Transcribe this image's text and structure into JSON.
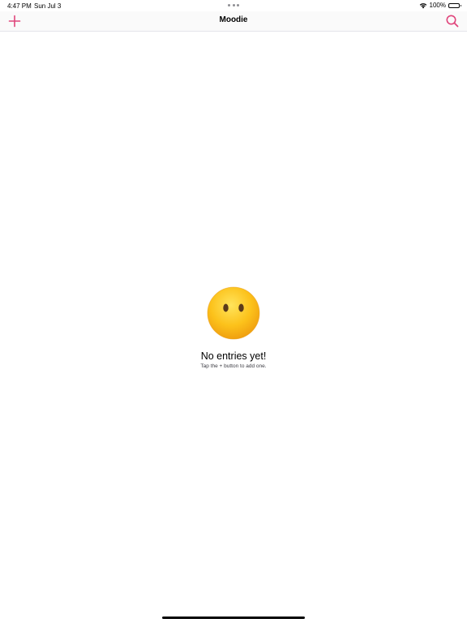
{
  "status_bar": {
    "time": "4:47 PM",
    "date": "Sun Jul 3",
    "battery": "100%",
    "battery_level": 1.0
  },
  "nav": {
    "title": "Moodie",
    "add_icon": "plus-icon",
    "search_icon": "magnifying-glass-icon"
  },
  "empty_state": {
    "emoji": "face-without-mouth",
    "title": "No entries yet!",
    "subtitle": "Tap the + button to add one."
  },
  "colors": {
    "accent": "#e0457b",
    "background": "#ffffff"
  }
}
